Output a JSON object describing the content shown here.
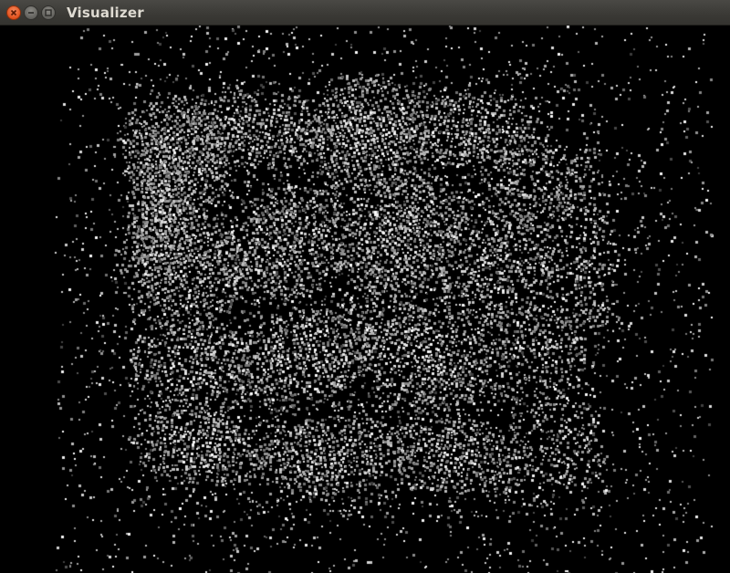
{
  "window": {
    "title": "Visualizer",
    "buttons": {
      "close": "close-icon",
      "minimize": "minimize-icon",
      "maximize": "maximize-icon"
    }
  },
  "viewport": {
    "background": "#000000",
    "content": "point-cloud",
    "point_color": "#ffffff"
  }
}
